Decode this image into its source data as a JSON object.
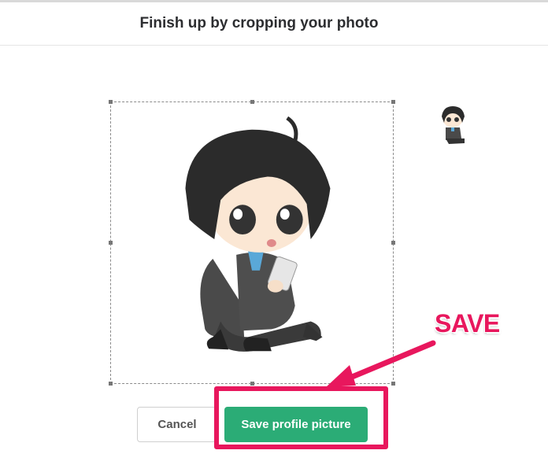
{
  "header": {
    "title": "Finish up by cropping your photo"
  },
  "buttons": {
    "cancel_label": "Cancel",
    "save_label": "Save profile picture"
  },
  "annotation": {
    "label": "SAVE"
  },
  "colors": {
    "accent_green": "#2bac76",
    "annotation_pink": "#e8175d"
  },
  "icons": [
    "chibi-photo",
    "chibi-thumbnail-preview",
    "arrow-annotation"
  ]
}
